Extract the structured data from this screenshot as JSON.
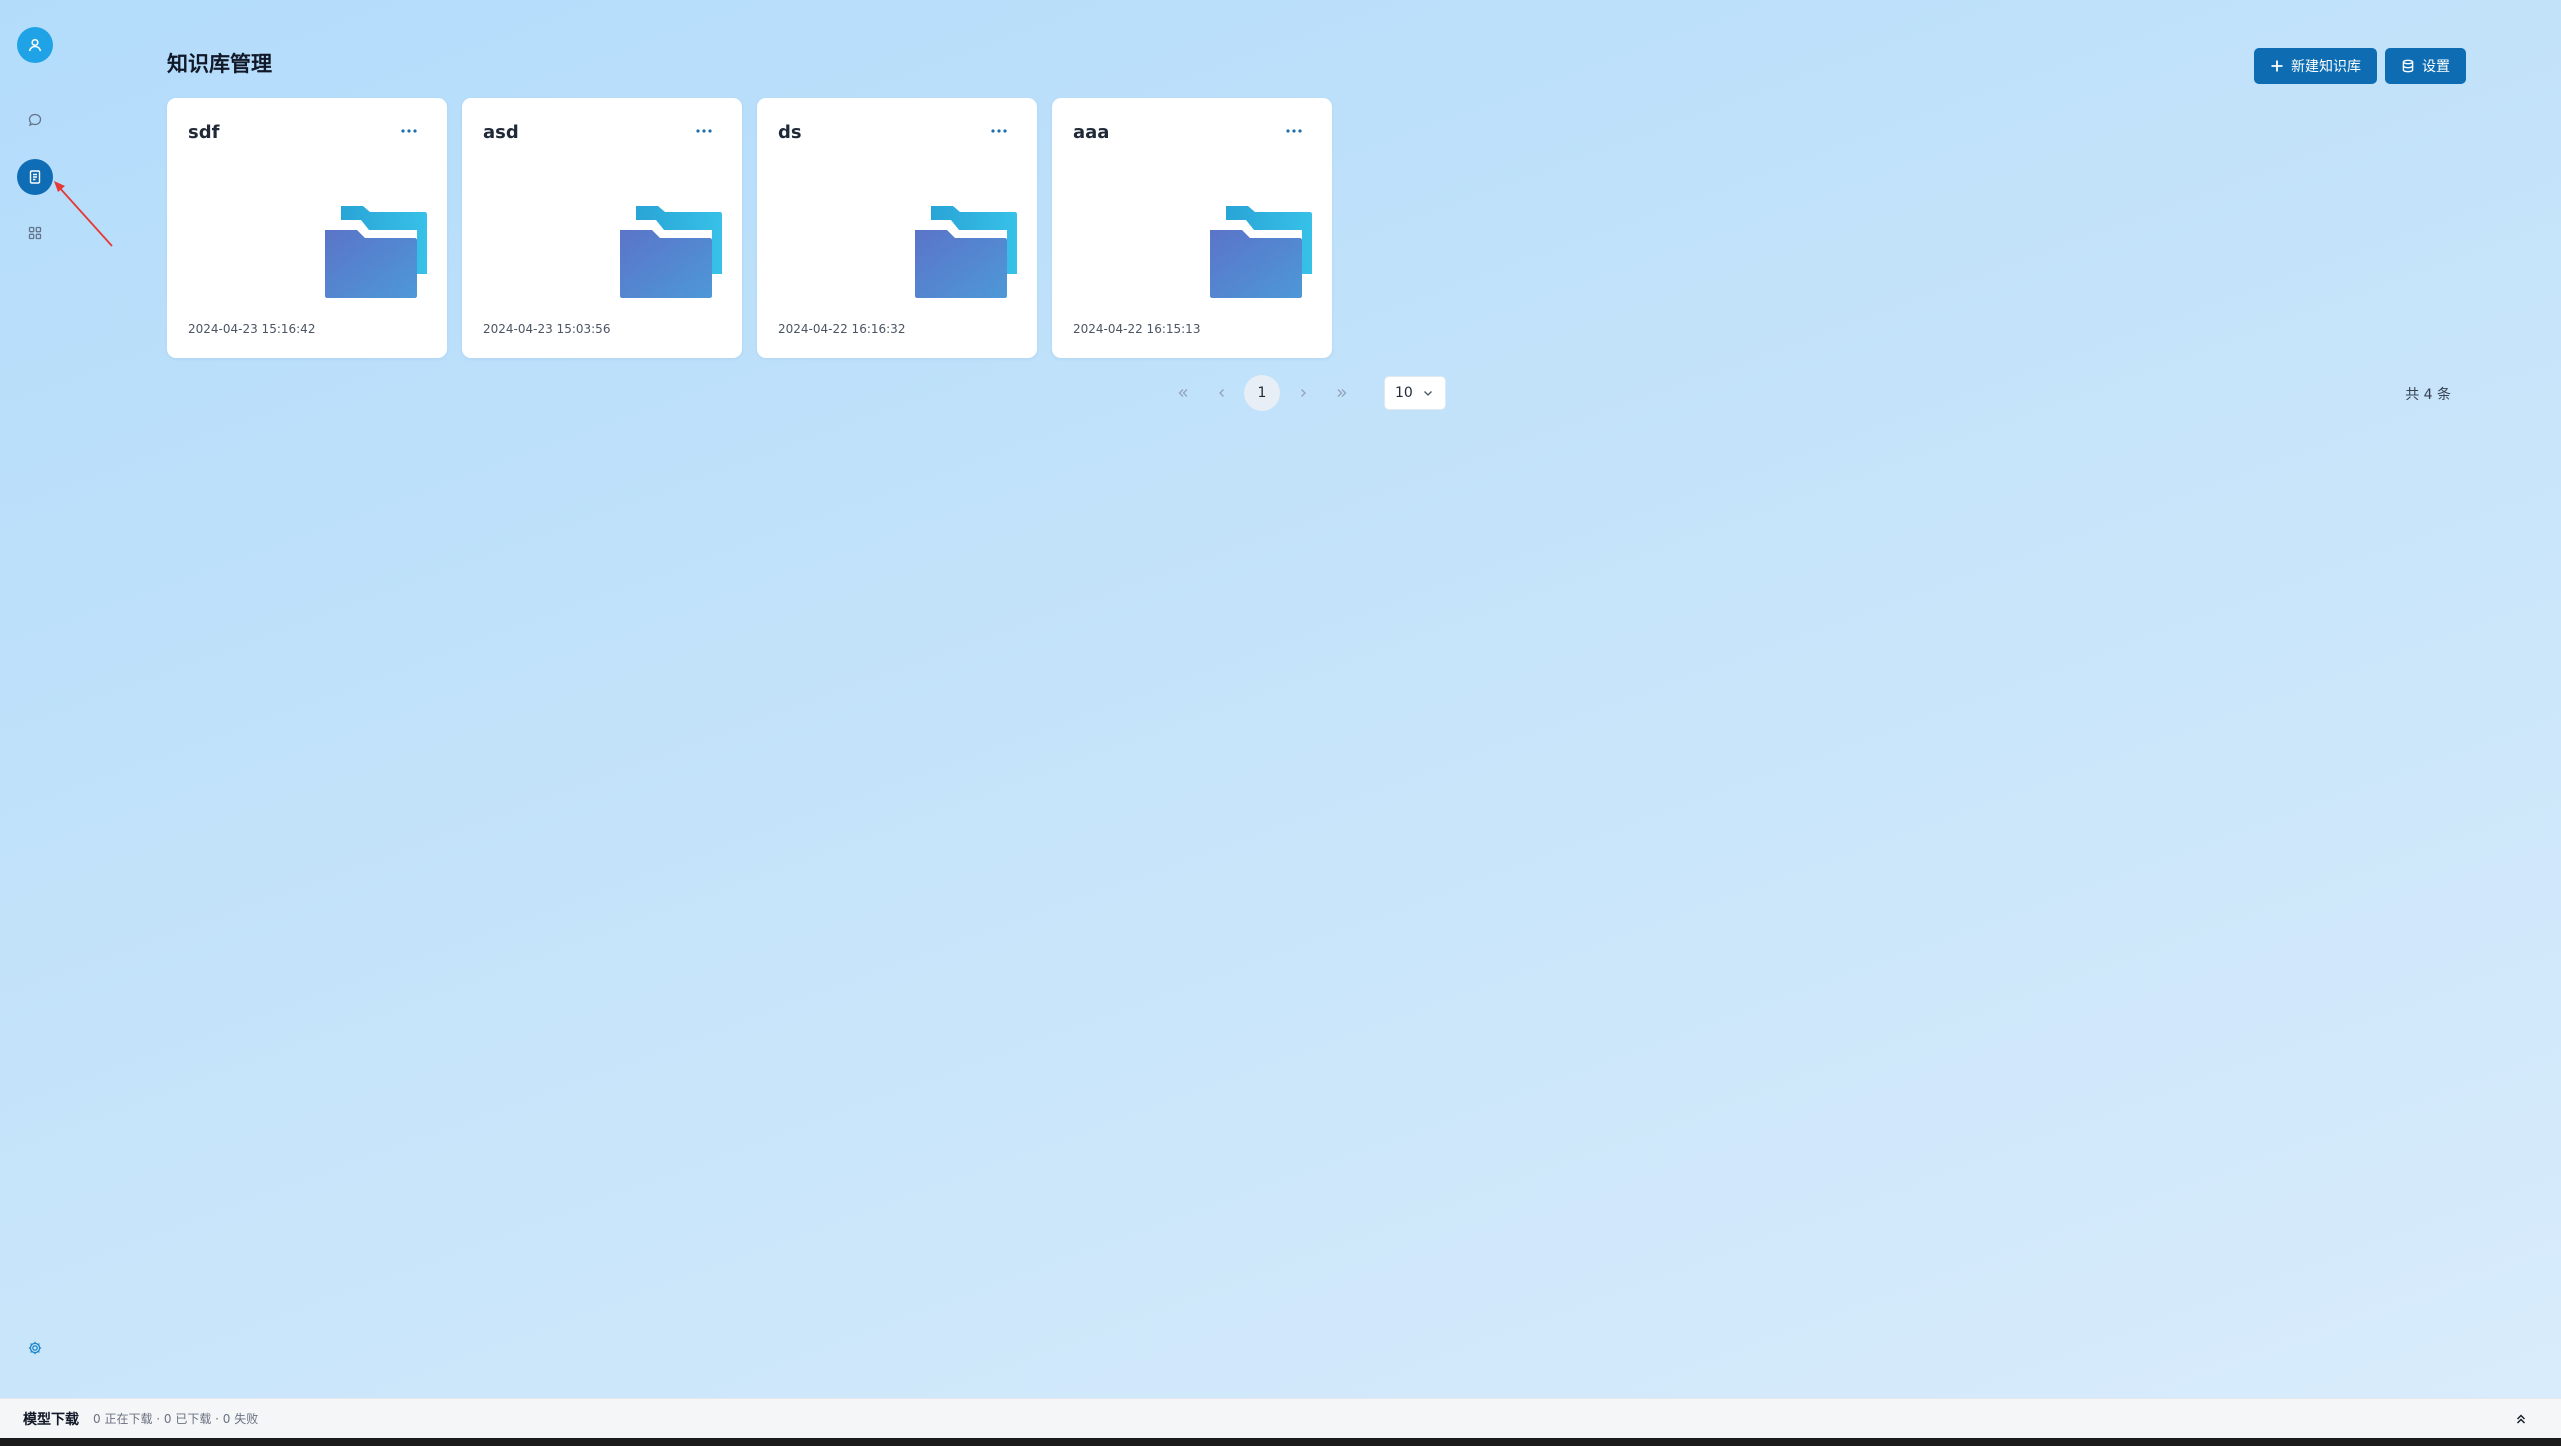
{
  "sidebar": {
    "items": [
      {
        "name": "user",
        "icon": "user-icon"
      },
      {
        "name": "chat",
        "icon": "chat-bubble-icon"
      },
      {
        "name": "knowledge-base",
        "icon": "document-icon",
        "active": true
      },
      {
        "name": "apps",
        "icon": "grid-icon"
      }
    ],
    "settings_icon": "gear-icon"
  },
  "header": {
    "title": "知识库管理",
    "new_button_label": "新建知识库",
    "new_button_icon": "plus-icon",
    "settings_button_label": "设置",
    "settings_button_icon": "database-icon"
  },
  "knowledge_bases": [
    {
      "name": "sdf",
      "created": "2024-04-23 15:16:42"
    },
    {
      "name": "asd",
      "created": "2024-04-23 15:03:56"
    },
    {
      "name": "ds",
      "created": "2024-04-22 16:16:32"
    },
    {
      "name": "aaa",
      "created": "2024-04-22 16:15:13"
    }
  ],
  "pagination": {
    "current_page": "1",
    "page_size": "10",
    "total_text": "共 4 条"
  },
  "download_bar": {
    "title": "模型下载",
    "status": "0 正在下载 · 0 已下载 · 0 失败"
  },
  "colors": {
    "accent": "#0d6cb2",
    "avatar": "#1fa3e6",
    "active_nav": "#0f6db6",
    "annotation_arrow": "#e53935",
    "background_top": "#b3dcfb",
    "background_bottom": "#d9ecfb"
  }
}
